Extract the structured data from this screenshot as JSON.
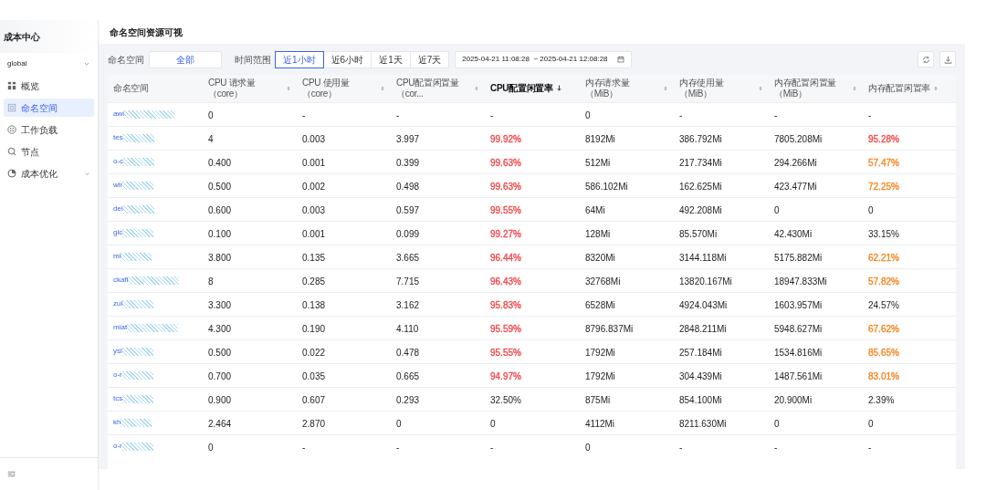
{
  "sidebar": {
    "title": "成本中心",
    "cluster_select": {
      "value": "global"
    },
    "items": [
      {
        "label": "概览",
        "kind": "grid",
        "selected": false,
        "expandable": false
      },
      {
        "label": "命名空间",
        "kind": "box",
        "selected": true,
        "expandable": false
      },
      {
        "label": "工作负载",
        "kind": "dots",
        "selected": false,
        "expandable": false
      },
      {
        "label": "节点",
        "kind": "search",
        "selected": false,
        "expandable": false
      },
      {
        "label": "成本优化",
        "kind": "pie",
        "selected": false,
        "expandable": true
      }
    ]
  },
  "page_title": "命名空间资源可视",
  "filters": {
    "namespace_label": "命名空间",
    "namespace_value": "全部",
    "time_label": "时间范围",
    "time_options": [
      {
        "label": "近1小时",
        "selected": true
      },
      {
        "label": "近6小时",
        "selected": false
      },
      {
        "label": "近1天",
        "selected": false
      },
      {
        "label": "近7天",
        "selected": false
      }
    ],
    "date_range": "2025-04-21 11:08:28  ~ 2025-04-21 12:08:28"
  },
  "table": {
    "columns": [
      {
        "label": "命名空间",
        "sortable": false,
        "sorted": false
      },
      {
        "label": "CPU 请求量（core）",
        "sortable": true,
        "sorted": false
      },
      {
        "label": "CPU 使用量（core）",
        "sortable": true,
        "sorted": false
      },
      {
        "label": "CPU配置闲置量（cor...",
        "sortable": true,
        "sorted": false
      },
      {
        "label": "CPU配置闲置率",
        "sortable": true,
        "sorted": true
      },
      {
        "label": "内存请求量（MiB）",
        "sortable": true,
        "sorted": false
      },
      {
        "label": "内存使用量（MiB）",
        "sortable": true,
        "sorted": false
      },
      {
        "label": "内存配置闲置量（MiB）",
        "sortable": true,
        "sorted": false
      },
      {
        "label": "内存配置闲置率",
        "sortable": true,
        "sorted": false
      }
    ],
    "rows": [
      {
        "long_mask": true,
        "cells": [
          {
            "text": "awi"
          },
          {
            "text": "0"
          },
          {
            "text": "-"
          },
          {
            "text": "-"
          },
          {
            "text": "-"
          },
          {
            "text": "0"
          },
          {
            "text": "-"
          },
          {
            "text": "-"
          },
          {
            "text": "-"
          }
        ]
      },
      {
        "long_mask": false,
        "cells": [
          {
            "text": "tes"
          },
          {
            "text": "4"
          },
          {
            "text": "0.003"
          },
          {
            "text": "3.997"
          },
          {
            "text": "99.92%",
            "color": "#f0474a"
          },
          {
            "text": "8192Mi"
          },
          {
            "text": "386.792Mi"
          },
          {
            "text": "7805.208Mi"
          },
          {
            "text": "95.28%",
            "color": "#f0474a"
          }
        ]
      },
      {
        "long_mask": false,
        "cells": [
          {
            "text": "o-c"
          },
          {
            "text": "0.400"
          },
          {
            "text": "0.001"
          },
          {
            "text": "0.399"
          },
          {
            "text": "99.63%",
            "color": "#f0474a"
          },
          {
            "text": "512Mi"
          },
          {
            "text": "217.734Mi"
          },
          {
            "text": "294.266Mi"
          },
          {
            "text": "57.47%",
            "color": "#f7841f"
          }
        ]
      },
      {
        "long_mask": false,
        "cells": [
          {
            "text": "wir"
          },
          {
            "text": "0.500"
          },
          {
            "text": "0.002"
          },
          {
            "text": "0.498"
          },
          {
            "text": "99.63%",
            "color": "#f0474a"
          },
          {
            "text": "586.102Mi"
          },
          {
            "text": "162.625Mi"
          },
          {
            "text": "423.477Mi"
          },
          {
            "text": "72.25%",
            "color": "#f7841f"
          }
        ]
      },
      {
        "long_mask": false,
        "cells": [
          {
            "text": "dei"
          },
          {
            "text": "0.600"
          },
          {
            "text": "0.003"
          },
          {
            "text": "0.597"
          },
          {
            "text": "99.55%",
            "color": "#f0474a"
          },
          {
            "text": "64Mi"
          },
          {
            "text": "492.208Mi"
          },
          {
            "text": "0"
          },
          {
            "text": "0"
          }
        ]
      },
      {
        "long_mask": false,
        "cells": [
          {
            "text": "glc"
          },
          {
            "text": "0.100"
          },
          {
            "text": "0.001"
          },
          {
            "text": "0.099"
          },
          {
            "text": "99.27%",
            "color": "#f0474a"
          },
          {
            "text": "128Mi"
          },
          {
            "text": "85.570Mi"
          },
          {
            "text": "42.430Mi"
          },
          {
            "text": "33.15%"
          }
        ]
      },
      {
        "long_mask": false,
        "cells": [
          {
            "text": "mi"
          },
          {
            "text": "3.800"
          },
          {
            "text": "0.135"
          },
          {
            "text": "3.665"
          },
          {
            "text": "96.44%",
            "color": "#f0474a"
          },
          {
            "text": "8320Mi"
          },
          {
            "text": "3144.118Mi"
          },
          {
            "text": "5175.882Mi"
          },
          {
            "text": "62.21%",
            "color": "#f7841f"
          }
        ]
      },
      {
        "long_mask": true,
        "cells": [
          {
            "text": "ckafl"
          },
          {
            "text": "8"
          },
          {
            "text": "0.285"
          },
          {
            "text": "7.715"
          },
          {
            "text": "96.43%",
            "color": "#f0474a"
          },
          {
            "text": "32768Mi"
          },
          {
            "text": "13820.167Mi"
          },
          {
            "text": "18947.833Mi"
          },
          {
            "text": "57.82%",
            "color": "#f7841f"
          }
        ]
      },
      {
        "long_mask": false,
        "cells": [
          {
            "text": "zul"
          },
          {
            "text": "3.300"
          },
          {
            "text": "0.138"
          },
          {
            "text": "3.162"
          },
          {
            "text": "95.83%",
            "color": "#f0474a"
          },
          {
            "text": "6528Mi"
          },
          {
            "text": "4924.043Mi"
          },
          {
            "text": "1603.957Mi"
          },
          {
            "text": "24.57%"
          }
        ]
      },
      {
        "long_mask": true,
        "cells": [
          {
            "text": "miat"
          },
          {
            "text": "4.300"
          },
          {
            "text": "0.190"
          },
          {
            "text": "4.110"
          },
          {
            "text": "95.59%",
            "color": "#f0474a"
          },
          {
            "text": "8796.837Mi"
          },
          {
            "text": "2848.211Mi"
          },
          {
            "text": "5948.627Mi"
          },
          {
            "text": "67.62%",
            "color": "#f7841f"
          }
        ]
      },
      {
        "long_mask": false,
        "cells": [
          {
            "text": "ysl"
          },
          {
            "text": "0.500"
          },
          {
            "text": "0.022"
          },
          {
            "text": "0.478"
          },
          {
            "text": "95.55%",
            "color": "#f0474a"
          },
          {
            "text": "1792Mi"
          },
          {
            "text": "257.184Mi"
          },
          {
            "text": "1534.816Mi"
          },
          {
            "text": "85.65%",
            "color": "#f7841f"
          }
        ]
      },
      {
        "long_mask": false,
        "cells": [
          {
            "text": "o-r"
          },
          {
            "text": "0.700"
          },
          {
            "text": "0.035"
          },
          {
            "text": "0.665"
          },
          {
            "text": "94.97%",
            "color": "#f0474a"
          },
          {
            "text": "1792Mi"
          },
          {
            "text": "304.439Mi"
          },
          {
            "text": "1487.561Mi"
          },
          {
            "text": "83.01%",
            "color": "#f7841f"
          }
        ]
      },
      {
        "long_mask": false,
        "cells": [
          {
            "text": "tcs"
          },
          {
            "text": "0.900"
          },
          {
            "text": "0.607"
          },
          {
            "text": "0.293"
          },
          {
            "text": "32.50%"
          },
          {
            "text": "875Mi"
          },
          {
            "text": "854.100Mi"
          },
          {
            "text": "20.900Mi"
          },
          {
            "text": "2.39%"
          }
        ]
      },
      {
        "long_mask": false,
        "cells": [
          {
            "text": "kh"
          },
          {
            "text": "2.464"
          },
          {
            "text": "2.870"
          },
          {
            "text": "0"
          },
          {
            "text": "0"
          },
          {
            "text": "4112Mi"
          },
          {
            "text": "8211.630Mi"
          },
          {
            "text": "0"
          },
          {
            "text": "0"
          }
        ]
      },
      {
        "long_mask": false,
        "cells": [
          {
            "text": "o-r"
          },
          {
            "text": "0"
          },
          {
            "text": "-"
          },
          {
            "text": "-"
          },
          {
            "text": "-"
          },
          {
            "text": "0"
          },
          {
            "text": "-"
          },
          {
            "text": "-"
          },
          {
            "text": "-"
          }
        ]
      }
    ]
  }
}
